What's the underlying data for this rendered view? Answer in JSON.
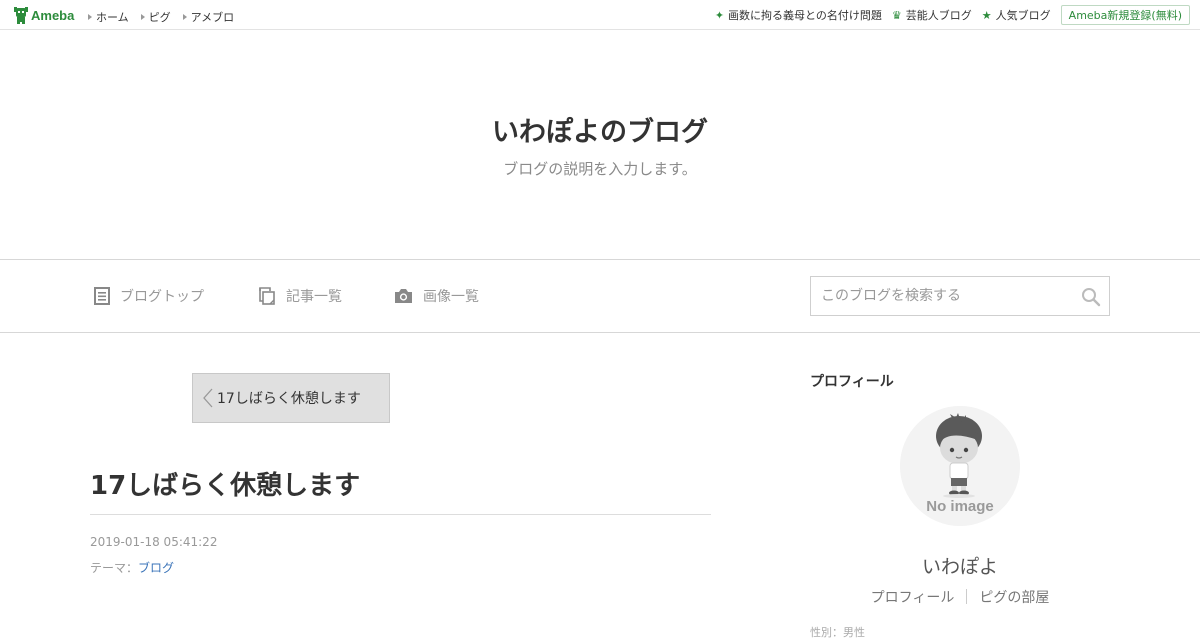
{
  "topbar": {
    "logo_text": "Ameba",
    "nav": [
      "ホーム",
      "ピグ",
      "アメブロ"
    ],
    "links": [
      {
        "icon": "sparkle-icon",
        "label": "画数に拘る義母との名付け問題"
      },
      {
        "icon": "crown-icon",
        "label": "芸能人ブログ"
      },
      {
        "icon": "star-icon",
        "label": "人気ブログ"
      }
    ],
    "signup_label": "Ameba新規登録(無料)"
  },
  "header": {
    "title": "いわぽよのブログ",
    "description": "ブログの説明を入力します。"
  },
  "nav": {
    "items": [
      {
        "icon": "document-icon",
        "label": "ブログトップ"
      },
      {
        "icon": "pages-icon",
        "label": "記事一覧"
      },
      {
        "icon": "camera-icon",
        "label": "画像一覧"
      }
    ],
    "search_placeholder": "このブログを検索する"
  },
  "entry": {
    "prev_label": "17しばらく休憩します",
    "title": "17しばらく休憩します",
    "date": "2019-01-18 05:41:22",
    "theme_label": "テーマ：",
    "theme_value": "ブログ"
  },
  "sidebar": {
    "heading": "プロフィール",
    "avatar_text": "No image",
    "name": "いわぽよ",
    "links": [
      "プロフィール",
      "ピグの部屋"
    ],
    "cut_text": "性別：男性"
  },
  "colors": {
    "accent": "#2d8c3c",
    "link": "#3a73b8"
  }
}
